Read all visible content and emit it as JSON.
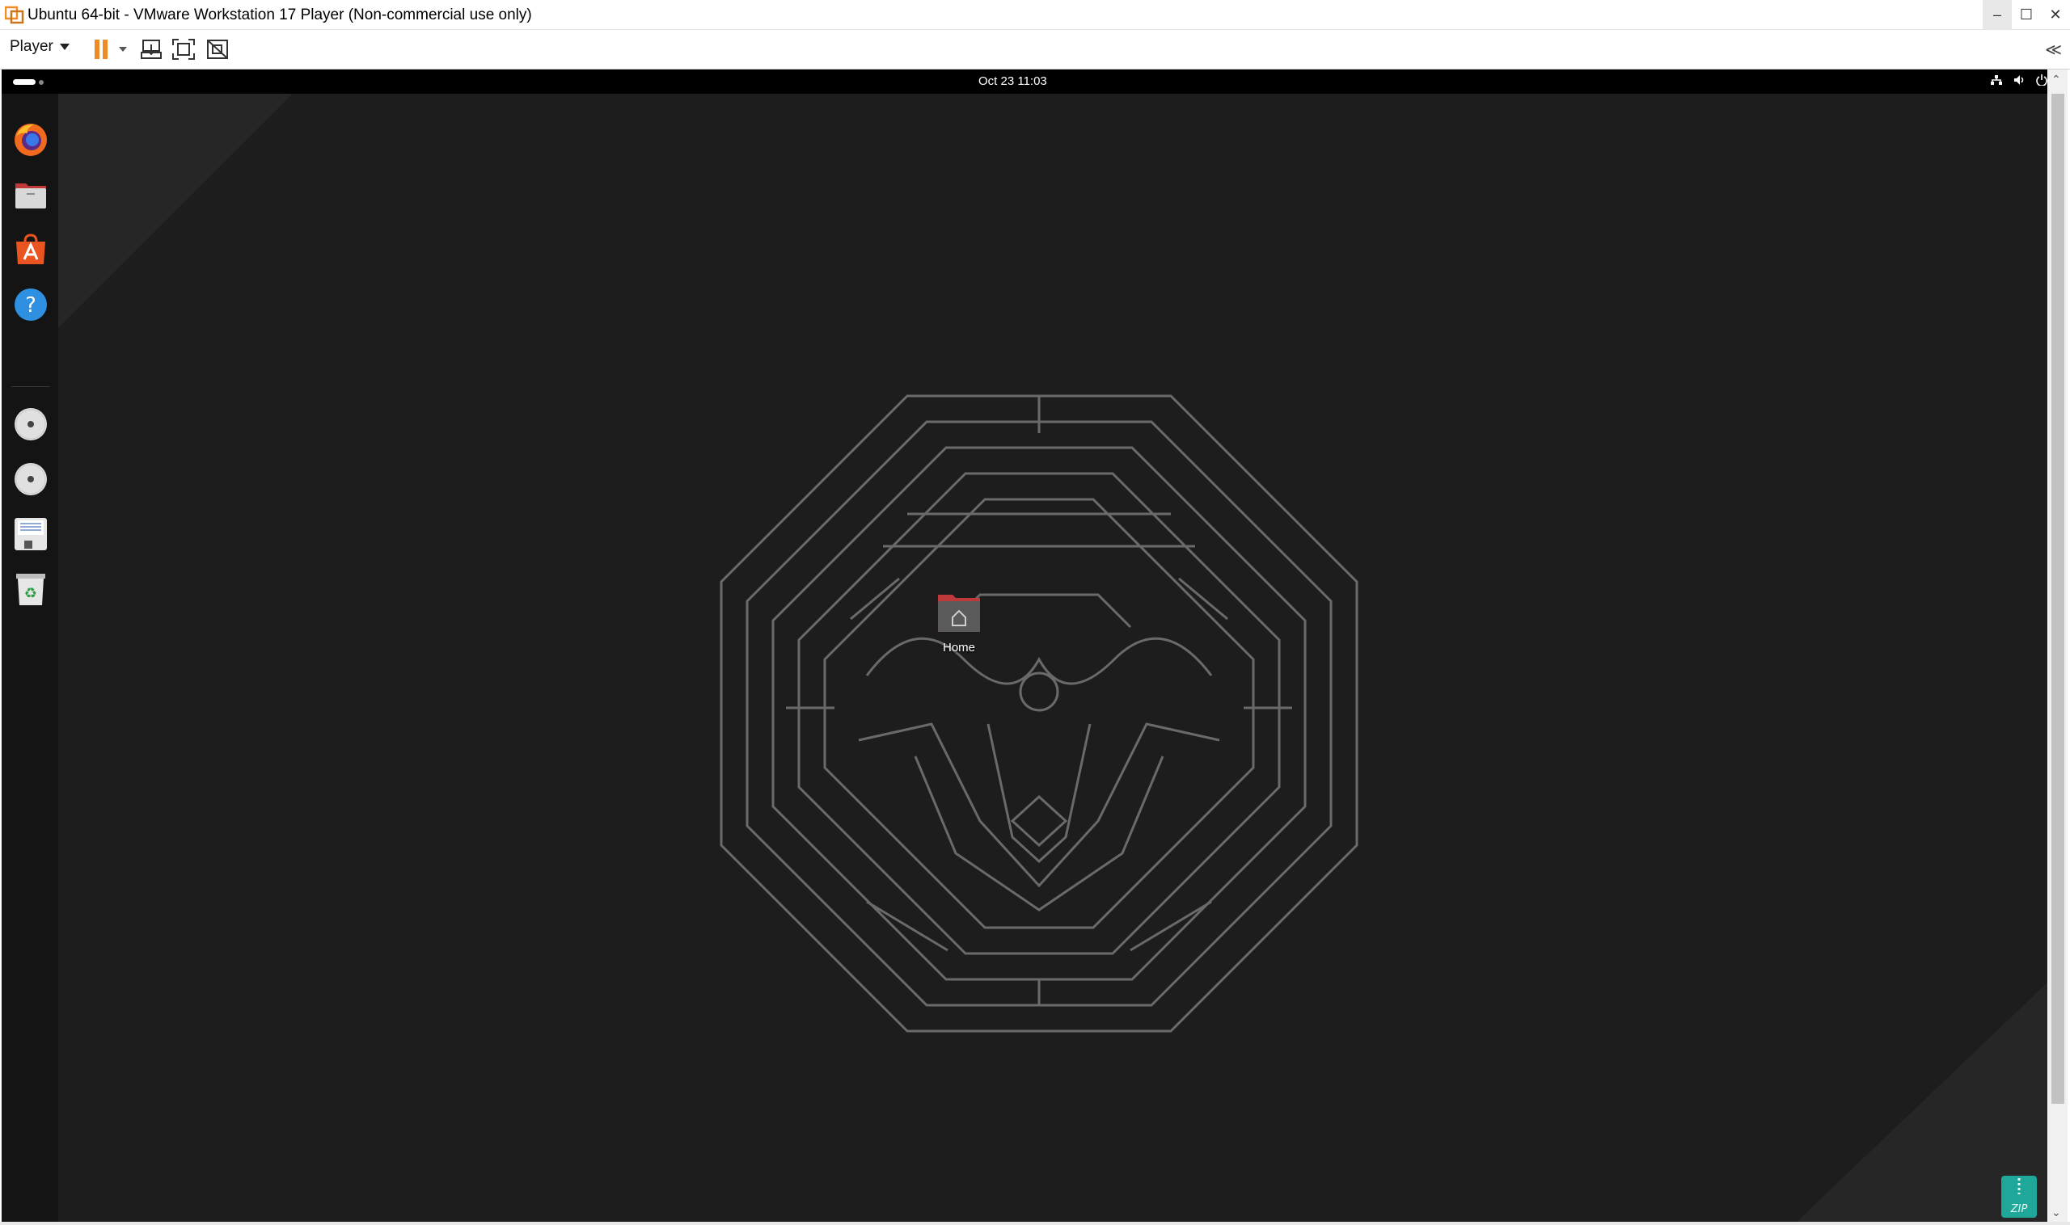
{
  "window": {
    "title": "Ubuntu 64-bit - VMware Workstation 17 Player (Non-commercial use only)",
    "minimize_glyph": "–",
    "maximize_glyph": "☐",
    "close_glyph": "✕"
  },
  "toolbar": {
    "player_menu_label": "Player",
    "accent_color": "#f08a24",
    "collapse_glyph": "≪"
  },
  "ubuntu": {
    "topbar": {
      "clock": "Oct 23  11:03"
    },
    "dock": {
      "items": [
        {
          "name": "firefox-icon"
        },
        {
          "name": "files-icon"
        },
        {
          "name": "app-center-icon"
        },
        {
          "name": "help-icon"
        },
        {
          "name": "disc-drive-icon"
        },
        {
          "name": "disc-drive-icon"
        },
        {
          "name": "floppy-drive-icon"
        },
        {
          "name": "trash-icon"
        }
      ]
    },
    "desktop": {
      "home_label": "Home",
      "zip_label": "ZIP"
    },
    "colors": {
      "background": "#1d1d1d",
      "maze": "#6a6a6a",
      "ubuntu_orange": "#e95420"
    }
  }
}
